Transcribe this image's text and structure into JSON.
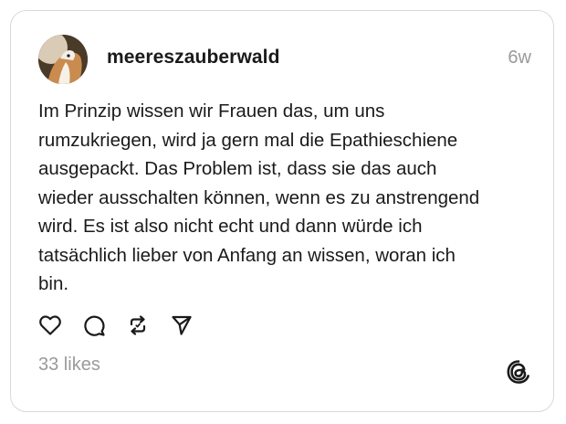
{
  "post": {
    "username": "meereszauberwald",
    "timestamp": "6w",
    "text": "Im Prinzip wissen wir Frauen das,  um uns\nrumzukriegen, wird ja gern mal die Epathieschiene\nausgepackt. Das Problem ist, dass sie das auch\nwieder ausschalten können,  wenn es zu anstrengend\nwird. Es ist also nicht echt und dann würde ich\ntatsächlich lieber von Anfang an wissen, woran ich\nbin.",
    "likes_label": "33 likes"
  },
  "actions": {
    "icons": [
      "heart-icon",
      "comment-icon",
      "repost-icon",
      "share-icon"
    ]
  },
  "brand": {
    "logo": "threads-logo-icon"
  },
  "colors": {
    "text": "#1a1a1a",
    "muted": "#9a9a9a",
    "border": "#d9d9d9",
    "background": "#ffffff"
  }
}
